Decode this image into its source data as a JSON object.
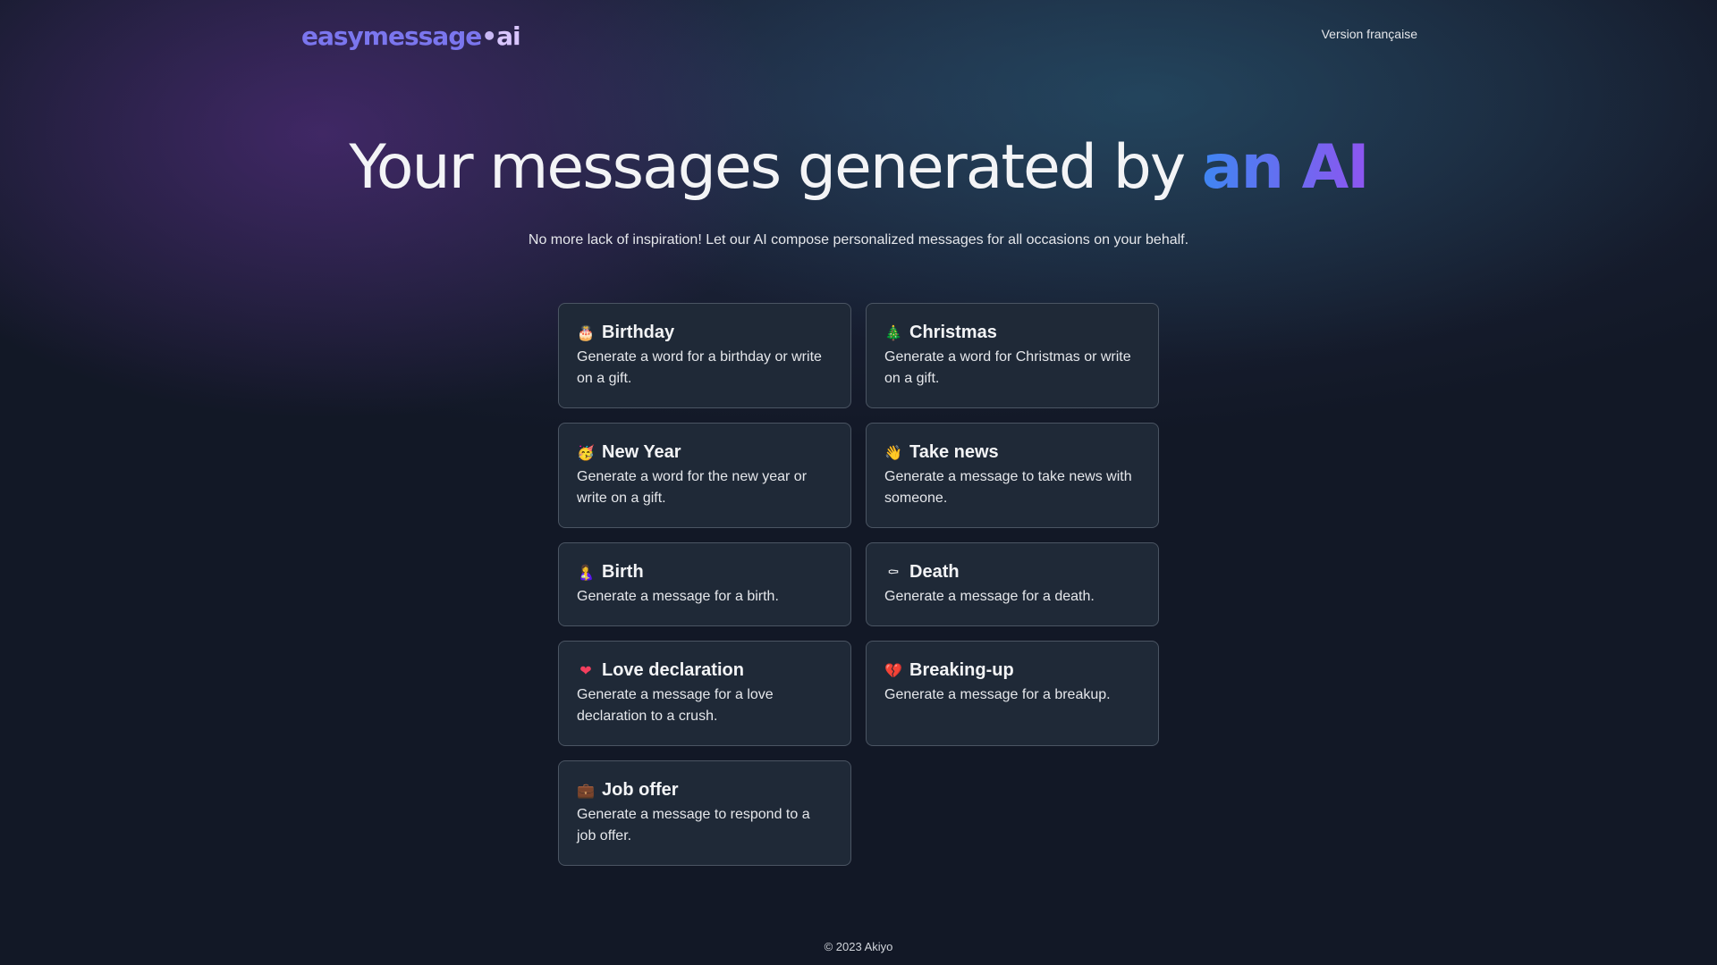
{
  "header": {
    "logo": {
      "part1": "easymessage",
      "separator": "•",
      "part2": "ai"
    },
    "language_link": "Version française"
  },
  "hero": {
    "title_prefix": "Your messages generated by ",
    "title_highlight": "an AI",
    "subtitle": "No more lack of inspiration! Let our AI compose personalized messages for all occasions on your behalf."
  },
  "cards": [
    {
      "icon": "birthday-cake-icon",
      "glyph": "🎂",
      "title": "Birthday",
      "description": "Generate a word for a birthday or write on a gift."
    },
    {
      "icon": "christmas-tree-icon",
      "glyph": "🎄",
      "title": "Christmas",
      "description": "Generate a word for Christmas or write on a gift."
    },
    {
      "icon": "party-face-icon",
      "glyph": "🥳",
      "title": "New Year",
      "description": "Generate a word for the new year or write on a gift."
    },
    {
      "icon": "waving-hand-icon",
      "glyph": "👋",
      "title": "Take news",
      "description": "Generate a message to take news with someone."
    },
    {
      "icon": "baby-feeding-icon",
      "glyph": "🤱",
      "title": "Birth",
      "description": "Generate a message for a birth."
    },
    {
      "icon": "coffin-icon",
      "glyph": "⚰",
      "title": "Death",
      "description": "Generate a message for a death."
    },
    {
      "icon": "heart-icon",
      "glyph": "❤",
      "title": "Love declaration",
      "description": "Generate a message for a love declaration to a crush."
    },
    {
      "icon": "broken-heart-icon",
      "glyph": "💔",
      "title": "Breaking-up",
      "description": "Generate a message for a breakup."
    },
    {
      "icon": "briefcase-icon",
      "glyph": "💼",
      "title": "Job offer",
      "description": "Generate a message to respond to a job offer."
    }
  ],
  "footer": {
    "copyright": "© 2023 Akiyo"
  },
  "colors": {
    "background": "#121826",
    "card_background": "#1f2937",
    "card_border": "#4b5563",
    "logo": "#7b76ee",
    "highlight_start": "#3f86f2",
    "highlight_end": "#8e55f0"
  }
}
